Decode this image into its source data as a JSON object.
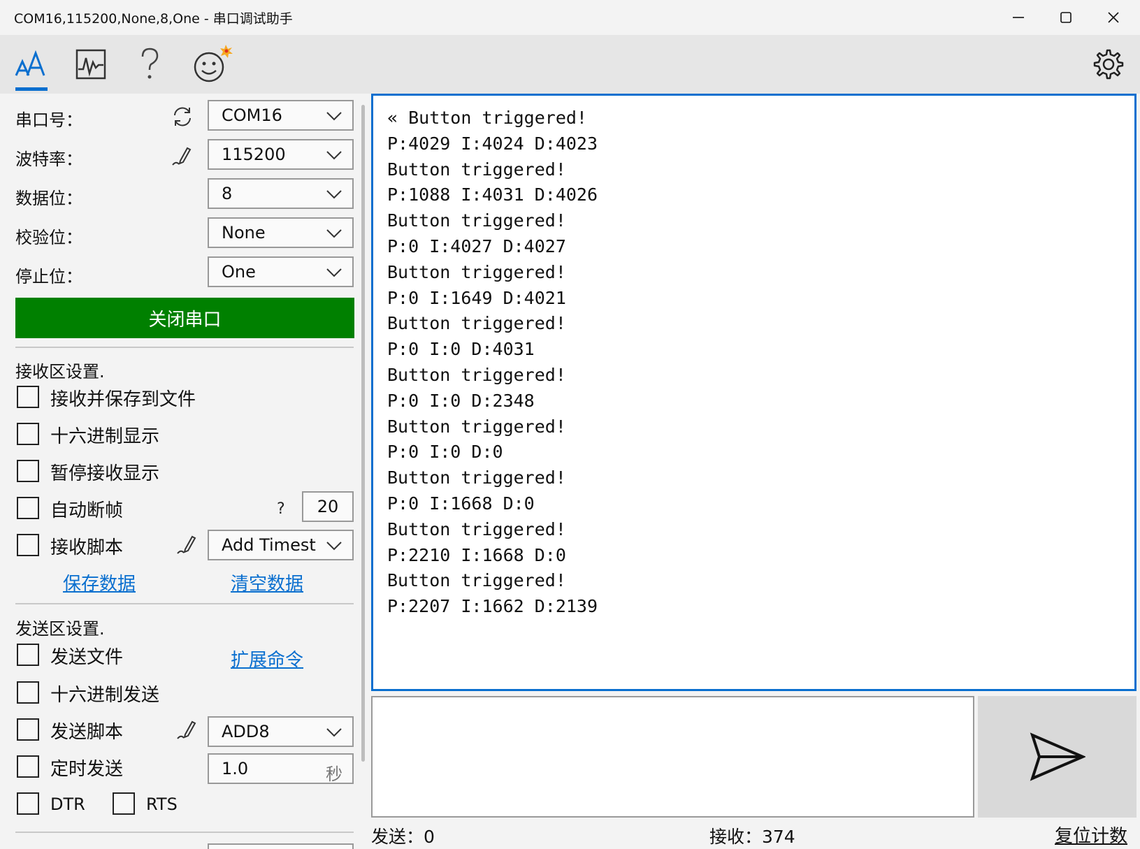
{
  "window": {
    "title": "COM16,115200,None,8,One - 串口调试助手",
    "controls": [
      "minimize-icon",
      "maximize-icon",
      "close-icon"
    ]
  },
  "toolbar": {
    "tabs": [
      {
        "icon": "font-size-icon",
        "active": true
      },
      {
        "icon": "waveform-chart-icon",
        "active": false
      },
      {
        "icon": "help-question-icon",
        "active": false
      },
      {
        "icon": "smiley-icon",
        "active": false
      }
    ],
    "settings_icon": "gear-icon",
    "accent_color": "#0a6fcf"
  },
  "serial": {
    "port_label": "串口号：",
    "port_value": "COM16",
    "baud_label": "波特率：",
    "baud_value": "115200",
    "databits_label": "数据位：",
    "databits_value": "8",
    "parity_label": "校验位：",
    "parity_value": "None",
    "stopbits_label": "停止位：",
    "stopbits_value": "One",
    "open_button": "关闭串口",
    "open_button_color": "#008000"
  },
  "receive_settings": {
    "title": "接收区设置.",
    "save_to_file": "接收并保存到文件",
    "hex_display": "十六进制显示",
    "pause_display": "暂停接收显示",
    "auto_frame": "自动断帧",
    "auto_frame_help": "?",
    "auto_frame_value": "20",
    "script": "接收脚本",
    "script_value": "Add Timest",
    "save_data": "保存数据",
    "clear_data": "清空数据"
  },
  "send_settings": {
    "title": "发送区设置.",
    "send_file": "发送文件",
    "extend_cmd": "扩展命令",
    "hex_send": "十六进制发送",
    "script": "发送脚本",
    "script_value": "ADD8",
    "timed_send": "定时发送",
    "timed_value": "1.0",
    "timed_unit": "秒",
    "dtr": "DTR",
    "rts": "RTS"
  },
  "receive_lines": [
    "« Button triggered!",
    "P:4029 I:4024 D:4023",
    "Button triggered!",
    "P:1088 I:4031 D:4026",
    "Button triggered!",
    "P:0 I:4027 D:4027",
    "Button triggered!",
    "P:0 I:1649 D:4021",
    "Button triggered!",
    "P:0 I:0 D:4031",
    "Button triggered!",
    "P:0 I:0 D:2348",
    "Button triggered!",
    "P:0 I:0 D:0",
    "Button triggered!",
    "P:0 I:1668 D:0",
    "Button triggered!",
    "P:2210 I:1668 D:0",
    "Button triggered!",
    "P:2207 I:1662 D:2139"
  ],
  "send_area": {
    "input_value": "",
    "send_icon": "send-paper-plane-icon"
  },
  "status": {
    "sent": "发送：0",
    "received": "接收：374",
    "reset": "复位计数"
  }
}
